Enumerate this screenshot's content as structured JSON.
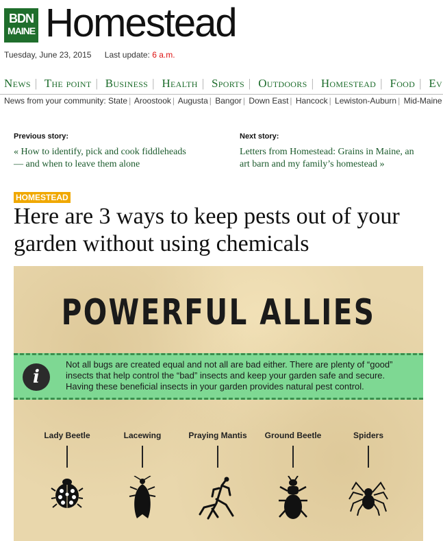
{
  "header": {
    "logo_line1": "BDN",
    "logo_line2": "MAINE",
    "section_title": "Homestead",
    "date": "Tuesday, June 23, 2015",
    "last_update_label": "Last update:",
    "last_update_time": "6 a.m."
  },
  "nav": {
    "items": [
      "News",
      "The point",
      "Business",
      "Health",
      "Sports",
      "Outdoors",
      "Homestead",
      "Food",
      "Ev"
    ]
  },
  "community": {
    "label": "News from your community:",
    "items": [
      "State",
      "Aroostook",
      "Augusta",
      "Bangor",
      "Down East",
      "Hancock",
      "Lewiston-Auburn",
      "Mid-Maine"
    ]
  },
  "story_nav": {
    "prev_label": "Previous story:",
    "prev_link": "« How to identify, pick and cook fiddleheads — and when to leave them alone",
    "next_label": "Next story:",
    "next_link": "Letters from Homestead: Grains in Maine, an art barn and my family’s homestead »"
  },
  "article": {
    "category": "HOMESTEAD",
    "headline": "Here are 3 ways to keep pests out of your garden without using chemicals"
  },
  "infographic": {
    "title": "POWERFUL ALLIES",
    "info_icon": "info-icon",
    "info_text": "Not all bugs are created equal and not all are bad either. There are plenty of “good” insects that help control the “bad” insects and keep your garden safe and secure. Having these beneficial insects in your garden provides natural pest control.",
    "bugs": [
      "Lady Beetle",
      "Lacewing",
      "Praying Mantis",
      "Ground Beetle",
      "Spiders"
    ]
  },
  "colors": {
    "brand_green": "#1f6e2c",
    "nav_green": "#1b6b2a",
    "update_red": "#dd1111",
    "category_badge": "#f0a800",
    "info_band": "#7ed893"
  }
}
